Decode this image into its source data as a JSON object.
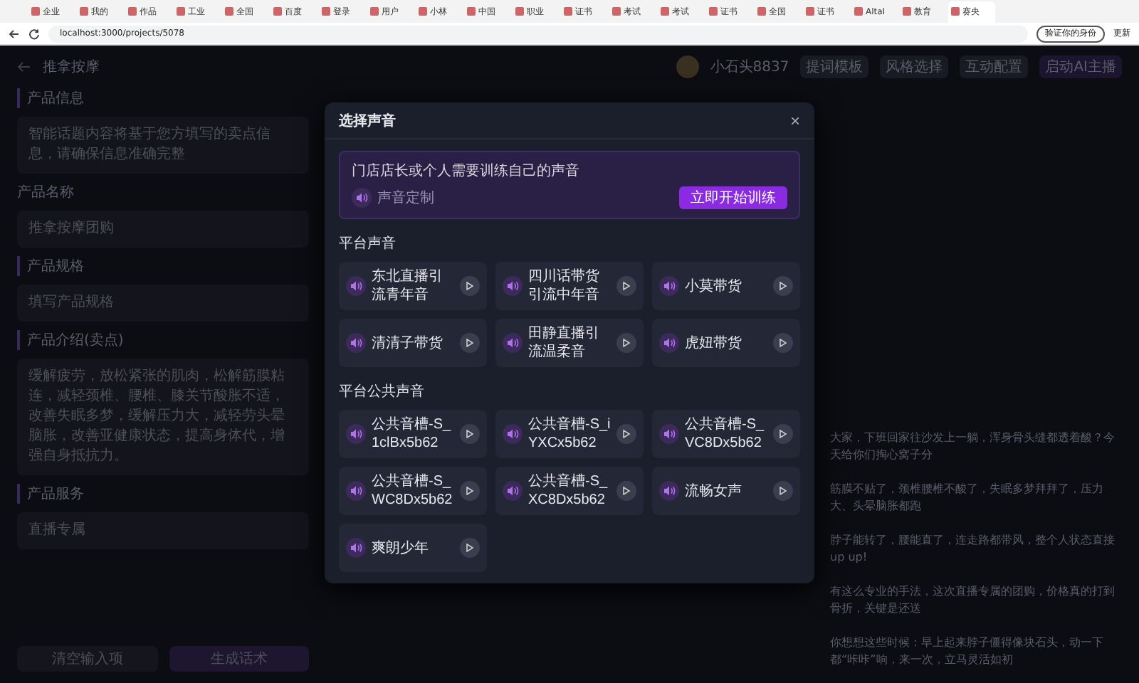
{
  "browser": {
    "tabs": [
      {
        "title": "企业",
        "selected": false
      },
      {
        "title": "我的",
        "selected": false
      },
      {
        "title": "作品",
        "selected": false
      },
      {
        "title": "工业",
        "selected": false
      },
      {
        "title": "全国",
        "selected": false
      },
      {
        "title": "百度",
        "selected": false
      },
      {
        "title": "登录",
        "selected": false
      },
      {
        "title": "用户",
        "selected": false
      },
      {
        "title": "小林",
        "selected": false
      },
      {
        "title": "中国",
        "selected": false
      },
      {
        "title": "职业",
        "selected": false
      },
      {
        "title": "证书",
        "selected": false
      },
      {
        "title": "考试",
        "selected": false
      },
      {
        "title": "考试",
        "selected": false
      },
      {
        "title": "证书",
        "selected": false
      },
      {
        "title": "全国",
        "selected": false
      },
      {
        "title": "证书",
        "selected": false
      },
      {
        "title": "AltaI",
        "selected": false
      },
      {
        "title": "教育",
        "selected": false
      },
      {
        "title": "赛央",
        "selected": true
      }
    ],
    "address": "localhost:3000/projects/5078",
    "profile_button": "验证你的身份",
    "update_button": "更新"
  },
  "app": {
    "title": "推拿按摩",
    "user_name": "小石头8837",
    "header_buttons": [
      "提词模板",
      "风格选择",
      "互动配置"
    ],
    "start_button": "启动AI主播",
    "form": {
      "section_title": "产品信息",
      "notice": "智能话题内容将基于您方填写的卖点信息，请确保信息准确完整",
      "fields": [
        {
          "kind": "heading",
          "label": "产品名称",
          "value": "推拿按摩团购"
        },
        {
          "kind": "section",
          "label": "产品规格",
          "placeholder": "填写产品规格"
        },
        {
          "kind": "section",
          "label": "产品介绍(卖点)",
          "value": "缓解疲劳，放松紧张的肌肉，松解筋膜粘连，减轻颈椎、腰椎、膝关节酸胀不适，改善失眠多梦，缓解压力大，减轻劳头晕脑胀，改善亚健康状态，提高身体代，增强自身抵抗力。"
        },
        {
          "kind": "section",
          "label": "产品服务",
          "value": "直播专属"
        }
      ],
      "clear_button": "清空输入项",
      "generate_button": "生成话术"
    },
    "script_lines": [
      "大家，下班回家往沙发上一躺，浑身骨头缝都透着酸？今天给你们掏心窝子分",
      "筋膜不贴了，颈椎腰椎不酸了，失眠多梦拜拜了，压力大、头晕脑胀都跑",
      "脖子能转了，腰能直了，连走路都带风，整个人状态直接up up!",
      "有这么专业的手法，这次直播专属的团购，价格真的打到骨折，关键是还送",
      "你想想这些时候：早上起来脖子僵得像块石头，动一下都“咔咔”响，来一次，立马灵活如初"
    ]
  },
  "dialog": {
    "title": "选择声音",
    "close": "×",
    "custom": {
      "text": "门店店长或个人需要训练自己的声音",
      "tag": "声音定制",
      "button": "立即开始训练"
    },
    "sections": [
      {
        "title": "平台声音",
        "voices": [
          "东北直播引流青年音",
          "四川话带货引流中年音",
          "小莫带货",
          "清清子带货",
          "田静直播引流温柔音",
          "虎妞带货"
        ]
      },
      {
        "title": "平台公共声音",
        "voices": [
          "公共音槽-S_1clBx5b62",
          "公共音槽-S_iYXCx5b62",
          "公共音槽-S_VC8Dx5b62",
          "公共音槽-S_WC8Dx5b62",
          "公共音槽-S_XC8Dx5b62",
          "流畅女声",
          "爽朗少年"
        ]
      }
    ]
  }
}
